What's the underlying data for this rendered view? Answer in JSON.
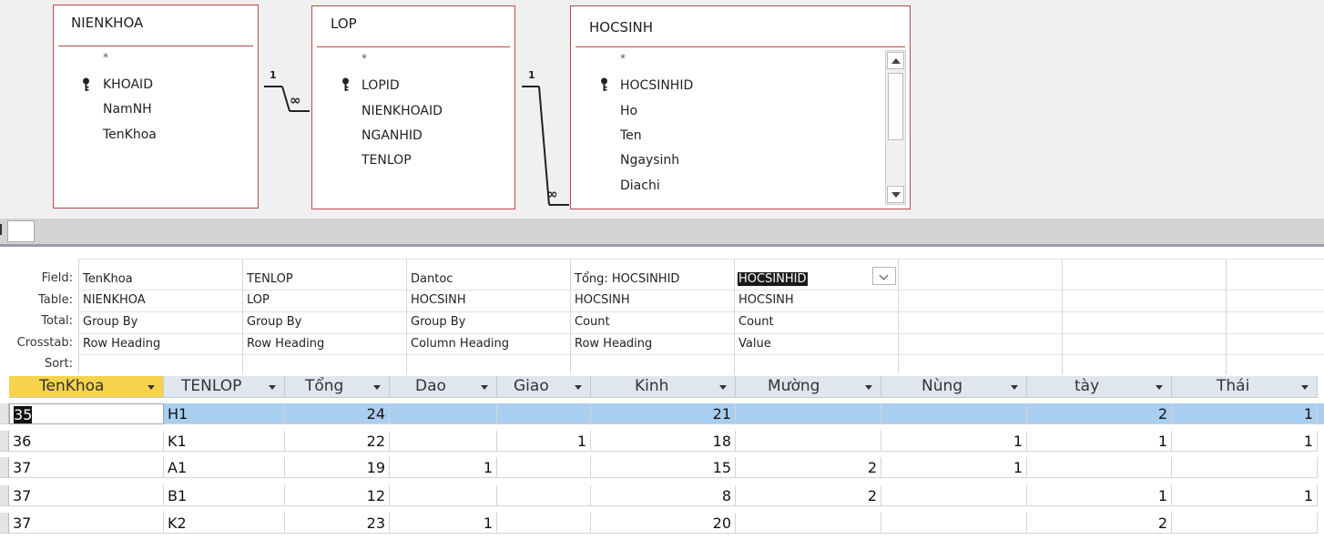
{
  "relationship_pane": {
    "tables": [
      {
        "name": "NIENKHOA",
        "fields": [
          "*",
          "KHOAID",
          "NamNH",
          "TenKhoa"
        ],
        "key_field": "KHOAID"
      },
      {
        "name": "LOP",
        "fields": [
          "*",
          "LOPID",
          "NIENKHOAID",
          "NGANHID",
          "TENLOP"
        ],
        "key_field": "LOPID"
      },
      {
        "name": "HOCSINH",
        "fields": [
          "*",
          "HOCSINHID",
          "Ho",
          "Ten",
          "Ngaysinh",
          "Diachi"
        ],
        "key_field": "HOCSINHID"
      }
    ],
    "relations": [
      {
        "from": "NIENKHOA",
        "to": "LOP",
        "one_label": "1",
        "many_label": "∞"
      },
      {
        "from": "LOP",
        "to": "HOCSINH",
        "one_label": "1",
        "many_label": "∞"
      }
    ]
  },
  "design_grid": {
    "row_labels": [
      "Field:",
      "Table:",
      "Total:",
      "Crosstab:",
      "Sort:"
    ],
    "columns": [
      {
        "field": "TenKhoa",
        "table": "NIENKHOA",
        "total": "Group By",
        "crosstab": "Row Heading",
        "sort": ""
      },
      {
        "field": "TENLOP",
        "table": "LOP",
        "total": "Group By",
        "crosstab": "Row Heading",
        "sort": ""
      },
      {
        "field": "Dantoc",
        "table": "HOCSINH",
        "total": "Group By",
        "crosstab": "Column Heading",
        "sort": ""
      },
      {
        "field": "Tổng: HOCSINHID",
        "table": "HOCSINH",
        "total": "Count",
        "crosstab": "Row Heading",
        "sort": ""
      },
      {
        "field": "HOCSINHID",
        "table": "HOCSINH",
        "total": "Count",
        "crosstab": "Value",
        "sort": ""
      },
      {
        "field": "",
        "table": "",
        "total": "",
        "crosstab": "",
        "sort": ""
      },
      {
        "field": "",
        "table": "",
        "total": "",
        "crosstab": "",
        "sort": ""
      },
      {
        "field": "",
        "table": "",
        "total": "",
        "crosstab": "",
        "sort": ""
      }
    ]
  },
  "datasheet": {
    "headers": [
      "TenKhoa",
      "TENLOP",
      "Tổng",
      "Dao",
      "Giao",
      "Kinh",
      "Mường",
      "Nùng",
      "tày",
      "Thái"
    ],
    "rows": [
      [
        "35",
        "H1",
        "24",
        "",
        "",
        "21",
        "",
        "",
        "2",
        "1"
      ],
      [
        "36",
        "K1",
        "22",
        "",
        "1",
        "18",
        "",
        "1",
        "1",
        "1"
      ],
      [
        "37",
        "A1",
        "19",
        "1",
        "",
        "15",
        "2",
        "1",
        "",
        ""
      ],
      [
        "37",
        "B1",
        "12",
        "",
        "",
        "8",
        "2",
        "",
        "1",
        "1"
      ],
      [
        "37",
        "K2",
        "23",
        "1",
        "",
        "20",
        "",
        "",
        "2",
        ""
      ]
    ]
  },
  "colors": {
    "table_border": "#b84a4a",
    "selected_header": "#f6d34b",
    "selected_row": "#a9cef0"
  }
}
